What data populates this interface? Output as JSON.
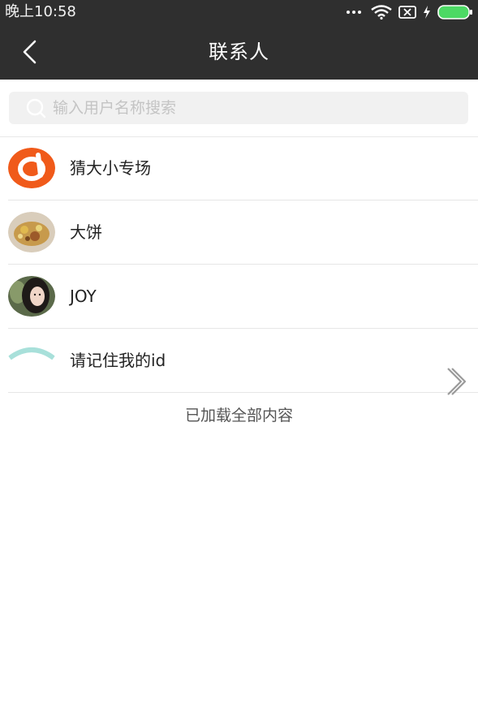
{
  "status": {
    "time": "晚上10:58"
  },
  "nav": {
    "title": "联系人"
  },
  "search": {
    "placeholder": "输入用户名称搜索",
    "value": ""
  },
  "contacts": [
    {
      "name": "猜大小专场",
      "avatar": "orange-brand-logo"
    },
    {
      "name": "大饼",
      "avatar": "food-photo"
    },
    {
      "name": "JOY",
      "avatar": "person-photo"
    },
    {
      "name": "请记住我的id",
      "avatar": "teal-arc-logo"
    }
  ],
  "footer": {
    "text": "已加载全部内容"
  },
  "colors": {
    "header": "#2f2f2f",
    "brand_orange": "#f05a1a",
    "teal": "#a8e0da",
    "battery": "#4cd964"
  }
}
